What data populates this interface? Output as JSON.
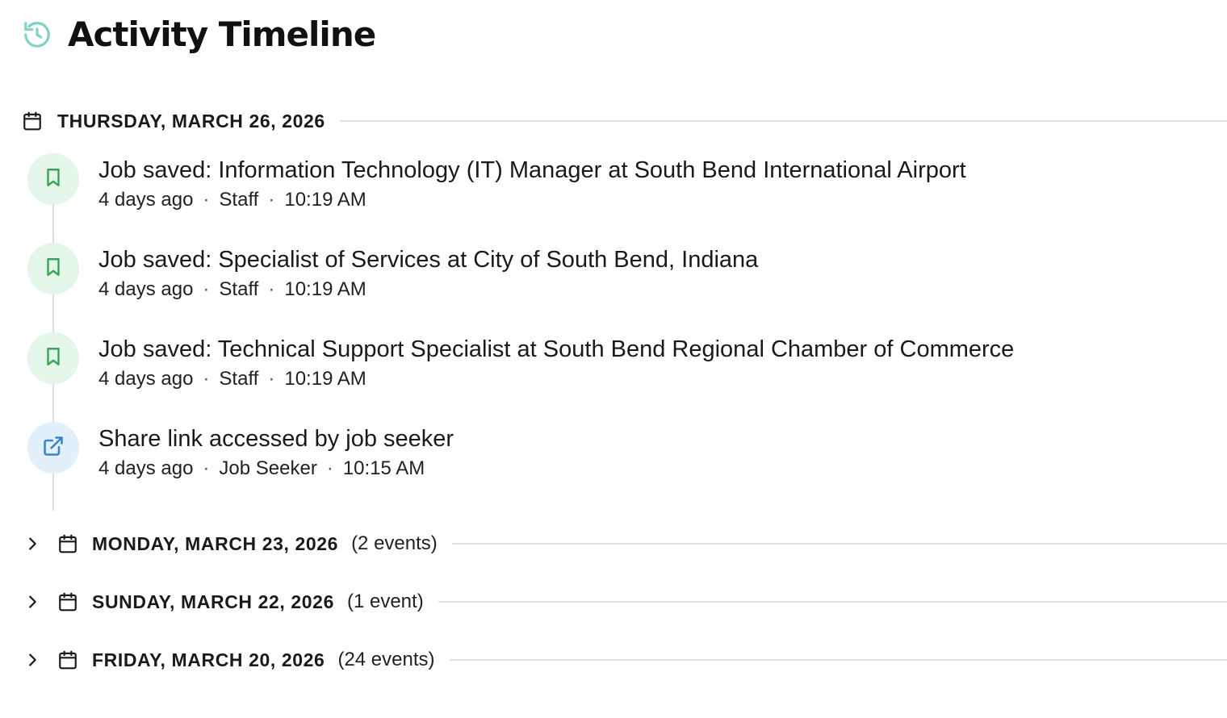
{
  "page": {
    "title": "Activity Timeline",
    "title_icon": "history-icon",
    "accent_color": "#7fd3c4"
  },
  "expanded_day": {
    "date_label": "THURSDAY, MARCH 26, 2026",
    "icon": "calendar-icon",
    "events": [
      {
        "icon": "bookmark-icon",
        "icon_color": "#3aa35a",
        "title": "Job saved: Information Technology (IT) Manager at South Bend International Airport",
        "relative_time": "4 days ago",
        "actor": "Staff",
        "time": "10:19 AM"
      },
      {
        "icon": "bookmark-icon",
        "icon_color": "#3aa35a",
        "title": "Job saved: Specialist of Services at City of South Bend, Indiana",
        "relative_time": "4 days ago",
        "actor": "Staff",
        "time": "10:19 AM"
      },
      {
        "icon": "bookmark-icon",
        "icon_color": "#3aa35a",
        "title": "Job saved: Technical Support Specialist at South Bend Regional Chamber of Commerce",
        "relative_time": "4 days ago",
        "actor": "Staff",
        "time": "10:19 AM"
      },
      {
        "icon": "external-link-icon",
        "icon_color": "#3a86c8",
        "title": "Share link accessed by job seeker",
        "relative_time": "4 days ago",
        "actor": "Job Seeker",
        "time": "10:15 AM"
      }
    ]
  },
  "collapsed_days": [
    {
      "date_label": "MONDAY, MARCH 23, 2026",
      "count_label": "(2 events)"
    },
    {
      "date_label": "SUNDAY, MARCH 22, 2026",
      "count_label": "(1 event)"
    },
    {
      "date_label": "FRIDAY, MARCH 20, 2026",
      "count_label": "(24 events)"
    }
  ],
  "separator": "·"
}
